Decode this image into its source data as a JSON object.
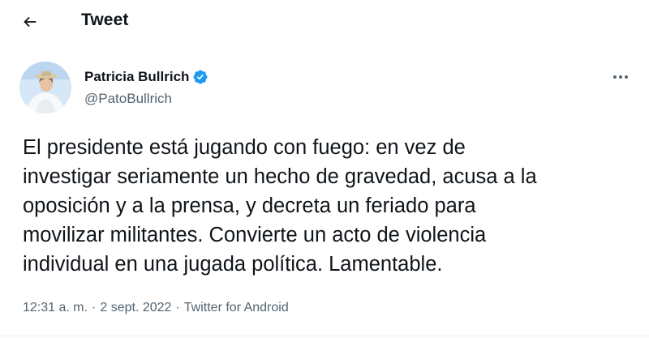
{
  "header": {
    "back_icon": "arrow-left-icon",
    "title": "Tweet"
  },
  "author": {
    "name": "Patricia Bullrich",
    "handle": "@PatoBullrich",
    "verified": true,
    "verified_color": "#1d9bf0"
  },
  "tweet": {
    "text": "El presidente está jugando con fuego: en vez de\ninvestigar seriamente un hecho de gravedad, acusa a la\noposición y a la prensa, y decreta un feriado para\nmovilizar militantes. Convierte un acto de violencia\nindividual en una jugada política. Lamentable."
  },
  "meta": {
    "time": "12:31 a. m.",
    "date": "2 sept. 2022",
    "source": "Twitter for Android",
    "separator": "·"
  }
}
